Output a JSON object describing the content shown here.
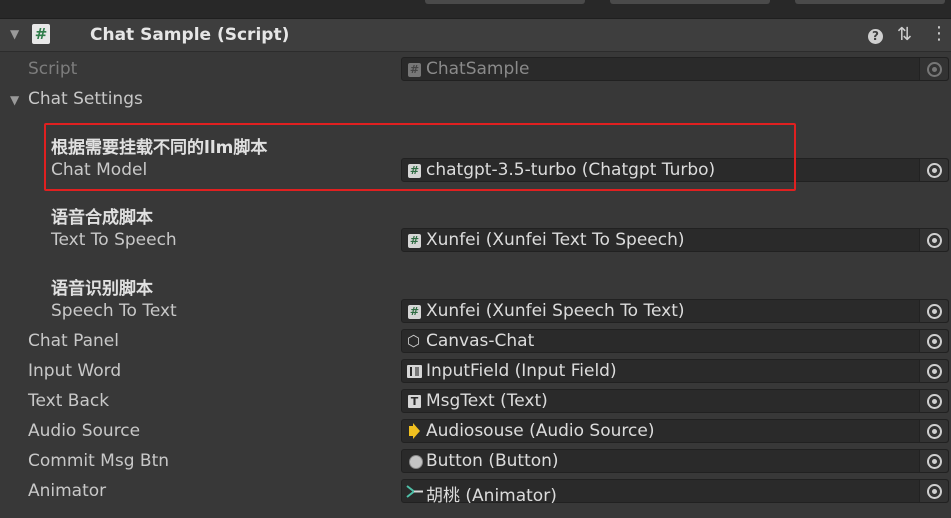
{
  "component": {
    "title": "Chat Sample (Script)",
    "help_icon": "?",
    "settings_icon": "⇅",
    "menu_icon": "⋮"
  },
  "script_field": {
    "label": "Script",
    "value": "ChatSample"
  },
  "chat_settings": {
    "label": "Chat Settings",
    "sections": [
      {
        "header": "根据需要挂载不同的llm脚本",
        "label": "Chat Model",
        "value": "chatgpt-3.5-turbo (Chatgpt Turbo)"
      },
      {
        "header": "语音合成脚本",
        "label": "Text To Speech",
        "value": "Xunfei (Xunfei Text To Speech)"
      },
      {
        "header": "语音识别脚本",
        "label": "Speech To Text",
        "value": "Xunfei (Xunfei Speech To Text)"
      }
    ]
  },
  "fields": [
    {
      "label": "Chat Panel",
      "value": "Canvas-Chat",
      "icon": "cube-icon"
    },
    {
      "label": "Input Word",
      "value": "InputField (Input Field)",
      "icon": "inputfield-icon"
    },
    {
      "label": "Text Back",
      "value": "MsgText (Text)",
      "icon": "text-icon"
    },
    {
      "label": "Audio Source",
      "value": "Audiosouse (Audio Source)",
      "icon": "speaker-icon"
    },
    {
      "label": "Commit Msg Btn",
      "value": "Button (Button)",
      "icon": "button-icon"
    },
    {
      "label": "Animator",
      "value": "胡桃 (Animator)",
      "icon": "animator-icon"
    }
  ],
  "colors": {
    "background": "#383838",
    "highlight_box": "#e02020",
    "script_icon_green": "#2f7d4a",
    "speaker_yellow": "#f0c020"
  }
}
